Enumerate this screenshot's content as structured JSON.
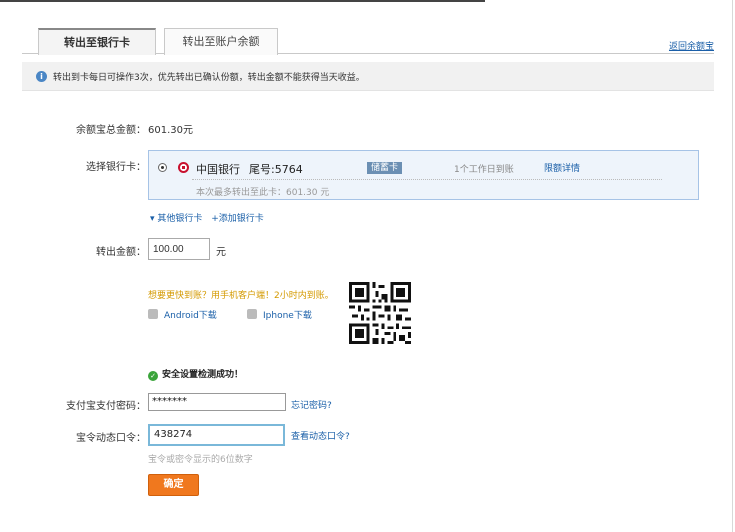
{
  "tabs": [
    {
      "label": "转出至银行卡",
      "active": true
    },
    {
      "label": "转出至账户余额",
      "active": false
    }
  ],
  "back_link": "返回余额宝",
  "notice": "转出到卡每日可操作3次，优先转出已确认份额，转出金额不能获得当天收益。",
  "total": {
    "label": "余额宝总金额：",
    "value": "601.30元"
  },
  "bank": {
    "label": "选择银行卡：",
    "name": "中国银行",
    "tail": "尾号:5764",
    "card_type": "储蓄卡",
    "arrival": "1个工作日到账",
    "limit_link": "限额详情",
    "max_text": "本次最多转出至此卡：601.30 元"
  },
  "card_links": {
    "other": "▾ 其他银行卡",
    "add": "+添加银行卡"
  },
  "amount": {
    "label": "转出金额：",
    "value": "100.00",
    "unit": "元"
  },
  "promo": "想要更快到账？用手机客户端！2小时内到账。",
  "downloads": {
    "android": "Android下载",
    "iphone": "Iphone下载"
  },
  "safety": "安全设置检测成功！",
  "password": {
    "label": "支付宝支付密码：",
    "value": "*******",
    "forgot": "忘记密码?"
  },
  "otp": {
    "label": "宝令动态口令：",
    "value": "438274",
    "link": "查看动态口令?",
    "hint": "宝令或密令显示的6位数字"
  },
  "confirm": "确定",
  "colors": {
    "accent": "#f0781e",
    "link": "#1a5fa8",
    "promo": "#d49a00"
  }
}
